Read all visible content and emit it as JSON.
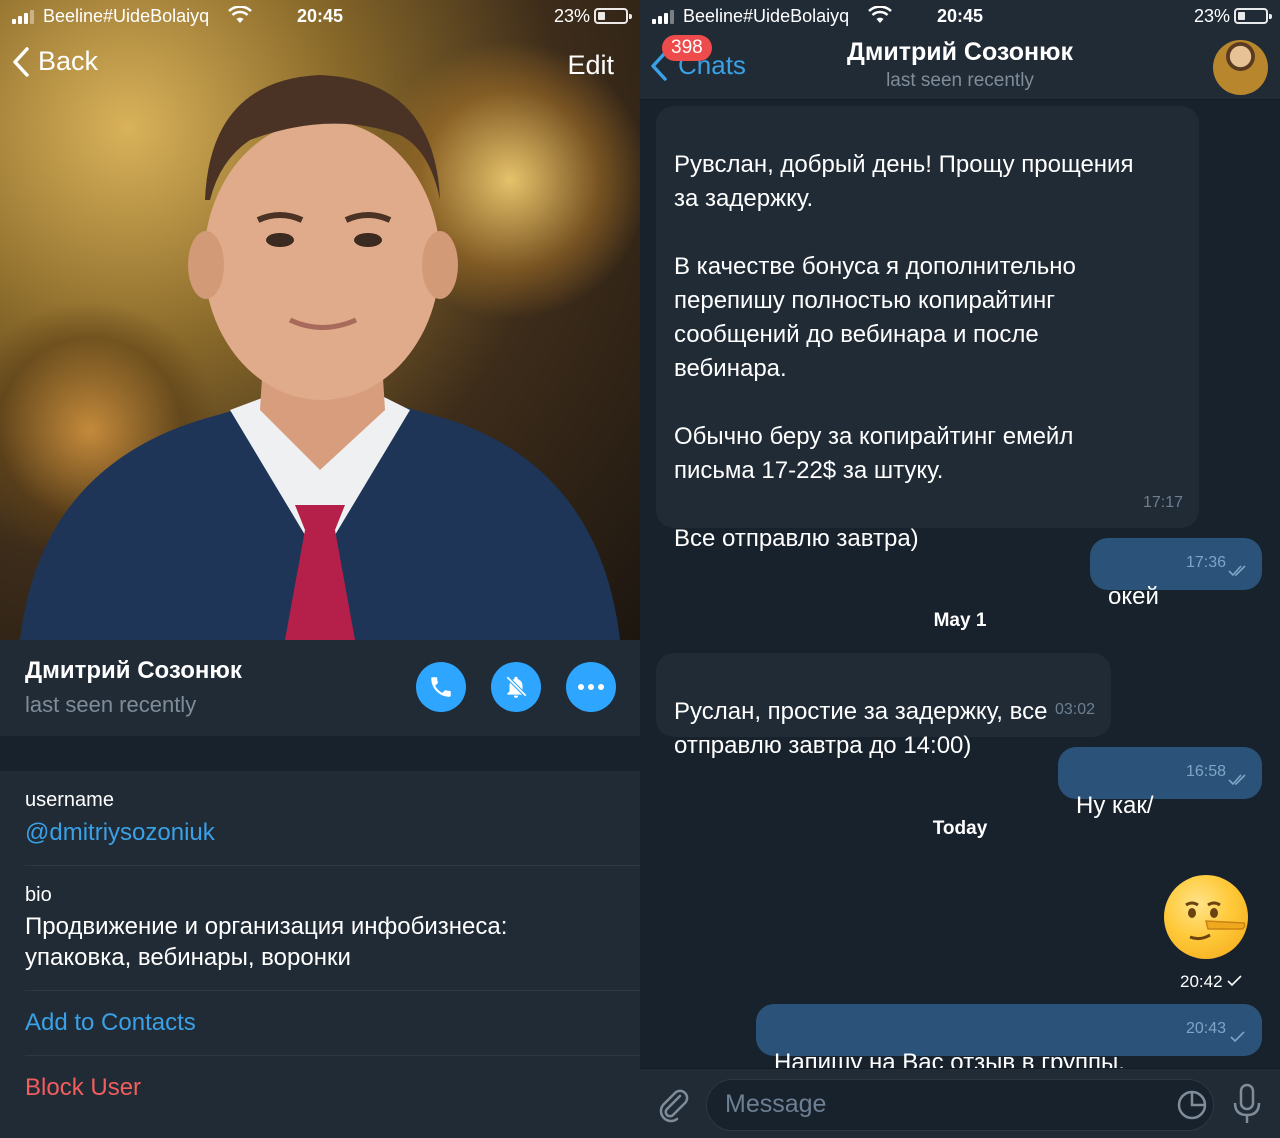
{
  "status": {
    "carrier": "Beeline#UideBolaiyq",
    "time": "20:45",
    "battery": "23%"
  },
  "profile": {
    "back_label": "Back",
    "edit_label": "Edit",
    "name": "Дмитрий Созонюк",
    "last_seen": "last seen recently",
    "username_label": "username",
    "username_value": "@dmitriysozoniuk",
    "bio_label": "bio",
    "bio_value": "Продвижение и организация инфобизнеса:\nупаковка, вебинары, воронки",
    "add_contact_label": "Add to Contacts",
    "block_label": "Block User"
  },
  "chat": {
    "back_label": "Chats",
    "unread_badge": "398",
    "title": "Дмитрий Созонюк",
    "subtitle": "last seen recently",
    "messages": [
      {
        "direction": "in",
        "text": "Рувслан, добрый день! Прощу прощения\nза задержку.\n\nВ качестве бонуса я дополнительно\nперепишу полностью копирайтинг\nсообщений до вебинара и после\nвебинара.\n\nОбычно беру за копирайтинг емейл\nписьма 17-22$ за штуку.\n\nВсе отправлю завтра)",
        "time": "17:17"
      },
      {
        "direction": "out",
        "text": "окей",
        "time": "17:36"
      },
      {
        "direction": "in",
        "text": "Руслан, простие за задержку, все\nотправлю завтра до 14:00)",
        "time": "03:02"
      },
      {
        "direction": "out",
        "text": "Ну как/",
        "time": "16:58"
      },
      {
        "direction": "out",
        "text": "Напишу на Вас отзыв в группы.",
        "time": "20:43"
      }
    ],
    "day_separators": [
      "May 1",
      "Today"
    ],
    "emoji_time": "20:42",
    "composer_placeholder": "Message"
  },
  "colors": {
    "accent": "#2ea6ff",
    "link": "#3aa1e6",
    "danger": "#f25d5d",
    "background": "#18222d",
    "surface": "#202b36",
    "outgoing_bubble": "#2b5278"
  }
}
